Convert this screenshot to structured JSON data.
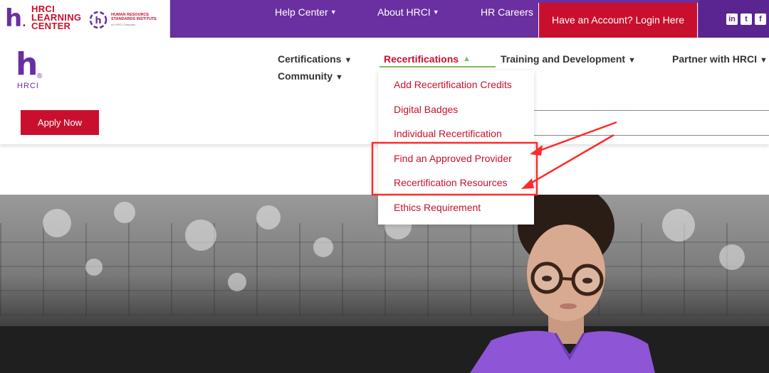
{
  "logo": {
    "learning_center_line1": "HRCI",
    "learning_center_line2": "LEARNING",
    "learning_center_line3": "CENTER",
    "hrsi_line1": "HUMAN RESOURCE",
    "hrsi_line2": "STANDARDS INSTITUTE",
    "hrsi_sub": "An HRCI Company",
    "hrci_wordmark": "HRCI"
  },
  "topbar": {
    "help_center": "Help Center",
    "about": "About HRCI",
    "careers": "HR Careers",
    "login": "Have an Account? Login Here",
    "social": [
      "in",
      "t",
      "f"
    ]
  },
  "nav": {
    "certifications": "Certifications",
    "community": "Community",
    "recertifications": "Recertifications",
    "training": "Training and Development",
    "partner": "Partner with HRCI"
  },
  "apply_button": "Apply Now",
  "dropdown": {
    "items": [
      "Add Recertification Credits",
      "Digital Badges",
      "Individual Recertification",
      "Find an Approved Provider",
      "Recertification Resources",
      "Ethics Requirement"
    ]
  },
  "colors": {
    "purple": "#6a2fa0",
    "red": "#c8102e",
    "green": "#7cbc5e",
    "annotation": "#ff2a2a"
  }
}
